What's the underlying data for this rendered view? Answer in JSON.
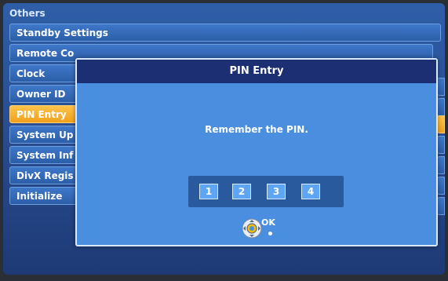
{
  "menu": {
    "title": "Others",
    "items": [
      {
        "label": "Standby Settings",
        "selected": false
      },
      {
        "label": "Remote Co",
        "selected": false
      },
      {
        "label": "Clock",
        "selected": false
      },
      {
        "label": "Owner ID",
        "selected": false
      },
      {
        "label": "PIN Entry",
        "selected": true
      },
      {
        "label": "System Up",
        "selected": false
      },
      {
        "label": "System Inf",
        "selected": false
      },
      {
        "label": "DivX Regis",
        "selected": false
      },
      {
        "label": "Initialize",
        "selected": false
      }
    ]
  },
  "dialog": {
    "title": "PIN Entry",
    "message": "Remember the PIN.",
    "pin_digits": [
      "1",
      "2",
      "3",
      "4"
    ],
    "ok_label": "OK",
    "ok_icon": "remote-ok-button-icon"
  },
  "colors": {
    "menu_item": "#3e78c9",
    "selected_item": "#f0a11d",
    "dialog_bg": "#4a8ee0",
    "dialog_header": "#1b2f72"
  }
}
